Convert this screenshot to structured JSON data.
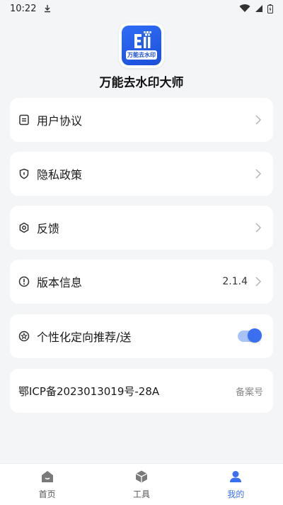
{
  "status_bar": {
    "time": "10:22"
  },
  "app": {
    "name": "万能去水印大师",
    "logo_text": "万能去水印"
  },
  "menu": {
    "user_agreement": "用户协议",
    "privacy_policy": "隐私政策",
    "feedback": "反馈",
    "version_info": "版本信息",
    "version_number": "2.1.4",
    "personalized": "个性化定向推荐/送",
    "personalized_enabled": true
  },
  "icp": {
    "number": "鄂ICP备2023013019号-28A",
    "tag": "备案号"
  },
  "bottom_nav": {
    "home": "首页",
    "tools": "工具",
    "mine": "我的",
    "active": "mine"
  },
  "colors": {
    "accent": "#3a6ff0",
    "background": "#f4f5f7",
    "card": "#ffffff"
  }
}
